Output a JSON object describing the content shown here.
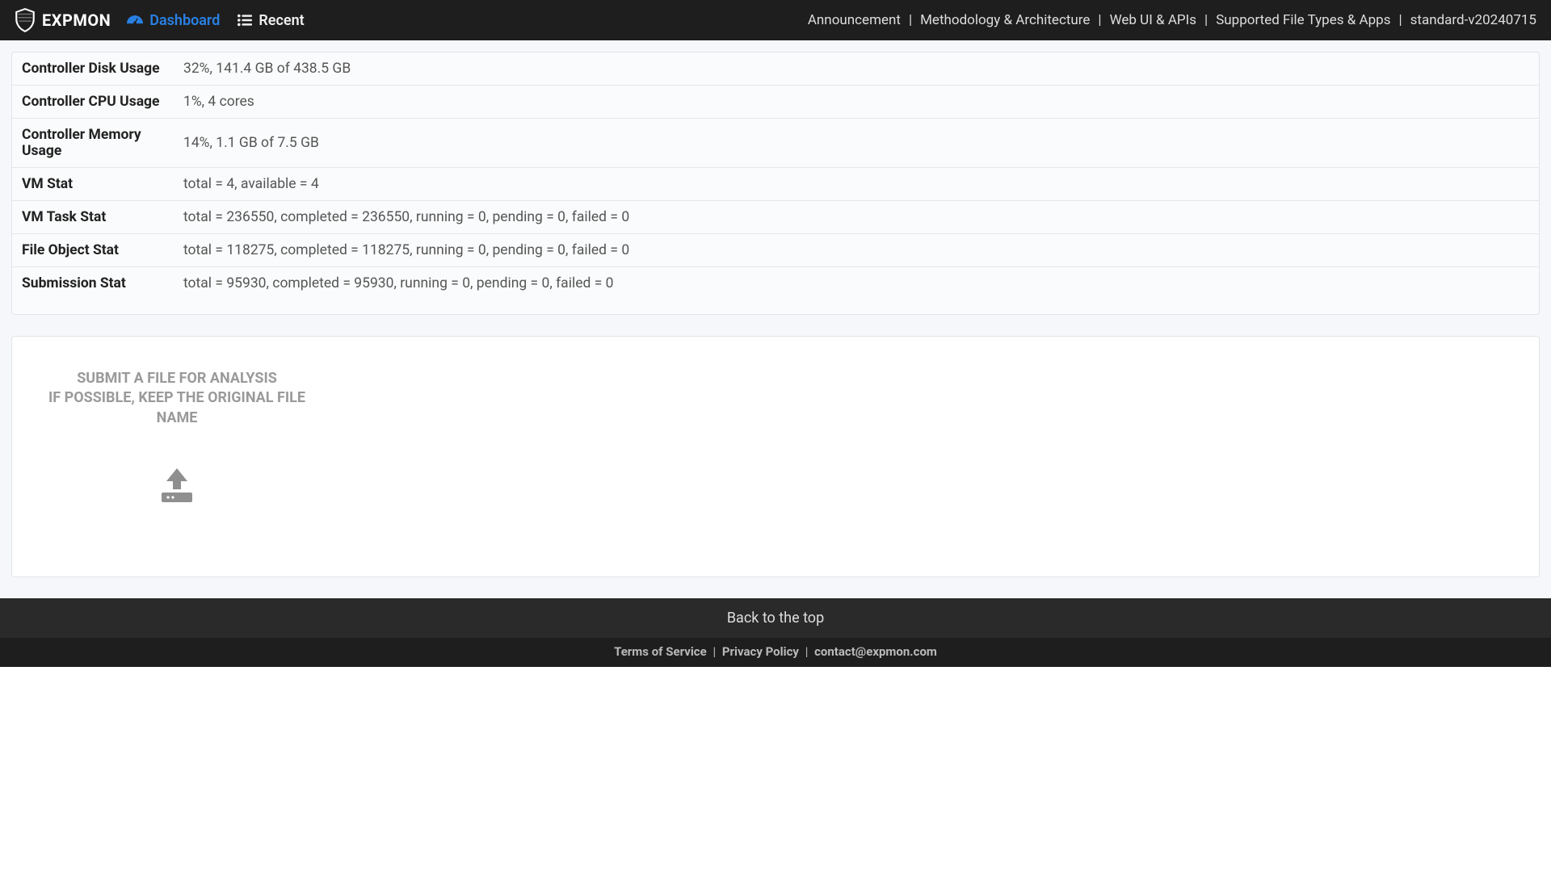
{
  "brand": {
    "name": "EXPMON"
  },
  "nav": {
    "dashboard": "Dashboard",
    "recent": "Recent"
  },
  "nav_right": {
    "items": [
      "Announcement",
      "Methodology & Architecture",
      "Web UI & APIs",
      "Supported File Types & Apps",
      "standard-v20240715"
    ],
    "sep": "|"
  },
  "stats": {
    "rows": [
      {
        "label": "Controller Disk Usage",
        "value": "32%, 141.4 GB of 438.5 GB"
      },
      {
        "label": "Controller CPU Usage",
        "value": "1%, 4 cores"
      },
      {
        "label": "Controller Memory Usage",
        "value": "14%, 1.1 GB of 7.5 GB"
      },
      {
        "label": "VM Stat",
        "value": "total = 4, available = 4"
      },
      {
        "label": "VM Task Stat",
        "value": "total = 236550, completed = 236550, running = 0, pending = 0, failed = 0"
      },
      {
        "label": "File Object Stat",
        "value": "total = 118275, completed = 118275, running = 0, pending = 0, failed = 0"
      },
      {
        "label": "Submission Stat",
        "value": "total = 95930, completed = 95930, running = 0, pending = 0, failed = 0"
      }
    ]
  },
  "upload": {
    "line1": "SUBMIT A FILE FOR ANALYSIS",
    "line2": "IF POSSIBLE, KEEP THE ORIGINAL FILE NAME"
  },
  "footer": {
    "back_to_top": "Back to the top",
    "terms": "Terms of Service",
    "privacy": "Privacy Policy",
    "contact": "contact@expmon.com",
    "sep": "|"
  }
}
